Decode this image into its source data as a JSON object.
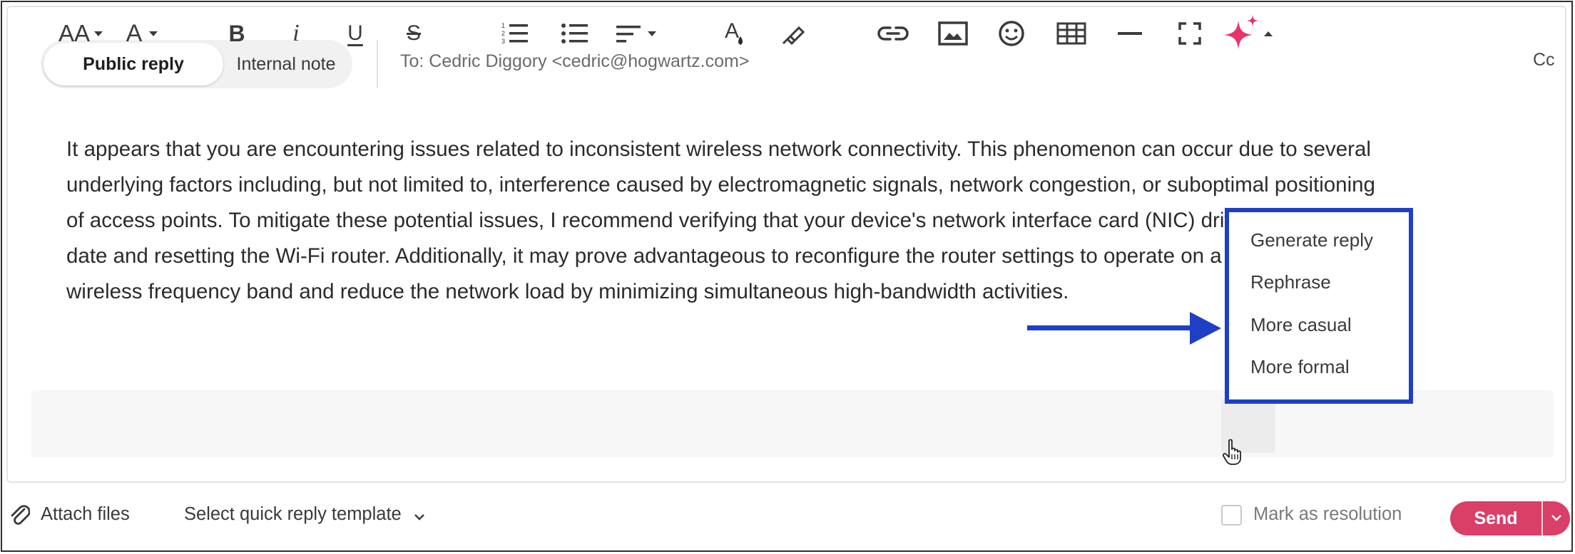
{
  "reply_tabs": {
    "public_reply": "Public reply",
    "internal_note": "Internal note"
  },
  "recipient": {
    "to_text": "To: Cedric Diggory <cedric@hogwartz.com>",
    "cc_label": "Cc"
  },
  "message": {
    "lines": [
      "It appears that you are encountering issues related to inconsistent wireless network connectivity. This phenomenon can occur due to several",
      "underlying factors including, but not limited to, interference caused by electromagnetic signals, network congestion, or suboptimal positioning",
      "of access points. To mitigate these potential issues, I recommend verifying that your device's network interface card (NIC) driver is up-to-",
      "date and resetting the Wi-Fi router. Additionally, it may prove advantageous to reconfigure the router settings to operate on a less congested",
      "wireless frequency band and reduce the network load by minimizing simultaneous high-bandwidth activities."
    ]
  },
  "toolbar": {
    "font_size_icon_text": "AA",
    "font_color_icon_text": "A",
    "bold_icon_text": "B",
    "italic_icon_text": "i",
    "underline_icon_text": "U",
    "strike_icon_text": "S",
    "icons": [
      "font-size-icon",
      "text-color-icon",
      "bold-icon",
      "italic-icon",
      "underline-icon",
      "strikethrough-icon",
      "numbered-list-icon",
      "bulleted-list-icon",
      "align-icon",
      "highlight-color-icon",
      "format-painter-icon",
      "link-icon",
      "image-icon",
      "emoji-icon",
      "table-icon",
      "horizontal-rule-icon",
      "fullscreen-icon",
      "ai-sparkle-icon"
    ]
  },
  "ai_menu": {
    "items": [
      "Generate reply",
      "Rephrase",
      "More casual",
      "More formal"
    ]
  },
  "footer": {
    "attach_label": "Attach files",
    "template_label": "Select quick reply template",
    "resolution_label": "Mark as resolution",
    "send_label": "Send"
  },
  "colors": {
    "accent_send": "#d93f67",
    "annotation_blue": "#1e3fc6",
    "sparkle_pink": "#e8336b"
  }
}
